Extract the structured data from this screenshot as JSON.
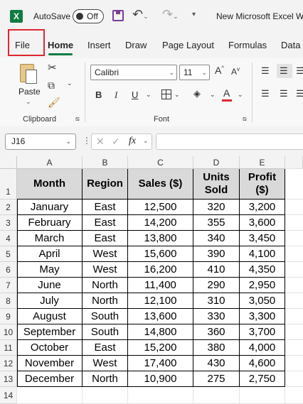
{
  "titlebar": {
    "app_icon": "X",
    "autosave_label": "AutoSave",
    "autosave_state": "Off",
    "document_title": "New Microsoft Excel W"
  },
  "tabs": [
    "File",
    "Home",
    "Insert",
    "Draw",
    "Page Layout",
    "Formulas",
    "Data"
  ],
  "active_tab": "Home",
  "ribbon": {
    "clipboard": {
      "paste_label": "Paste",
      "group_label": "Clipboard"
    },
    "font": {
      "font_name": "Calibri",
      "font_size": "11",
      "bold": "B",
      "italic": "I",
      "underline": "U",
      "font_color_letter": "A",
      "grow_letter": "A",
      "shrink_letter": "A",
      "group_label": "Font"
    },
    "accent_color": "#107c41",
    "font_color_bar": "#e0262f"
  },
  "formula_bar": {
    "name_box": "J16",
    "fx_label": "fx",
    "formula": ""
  },
  "columns": [
    "A",
    "B",
    "C",
    "D",
    "E"
  ],
  "rows": [
    "1",
    "2",
    "3",
    "4",
    "5",
    "6",
    "7",
    "8",
    "9",
    "10",
    "11",
    "12",
    "13",
    "14"
  ],
  "table": {
    "headers": [
      "Month",
      "Region",
      "Sales ($)",
      "Units Sold",
      "Profit ($)"
    ],
    "header_lines": [
      [
        "Month"
      ],
      [
        "Region"
      ],
      [
        "Sales ($)"
      ],
      [
        "Units",
        "Sold"
      ],
      [
        "Profit",
        "($)"
      ]
    ],
    "rows": [
      [
        "January",
        "East",
        "12,500",
        "320",
        "3,200"
      ],
      [
        "February",
        "East",
        "14,200",
        "355",
        "3,600"
      ],
      [
        "March",
        "East",
        "13,800",
        "340",
        "3,450"
      ],
      [
        "April",
        "West",
        "15,600",
        "390",
        "4,100"
      ],
      [
        "May",
        "West",
        "16,200",
        "410",
        "4,350"
      ],
      [
        "June",
        "North",
        "11,400",
        "290",
        "2,950"
      ],
      [
        "July",
        "North",
        "12,100",
        "310",
        "3,050"
      ],
      [
        "August",
        "South",
        "13,600",
        "330",
        "3,300"
      ],
      [
        "September",
        "South",
        "14,800",
        "360",
        "3,700"
      ],
      [
        "October",
        "East",
        "15,200",
        "380",
        "4,000"
      ],
      [
        "November",
        "West",
        "17,400",
        "430",
        "4,600"
      ],
      [
        "December",
        "North",
        "10,900",
        "275",
        "2,750"
      ]
    ]
  }
}
